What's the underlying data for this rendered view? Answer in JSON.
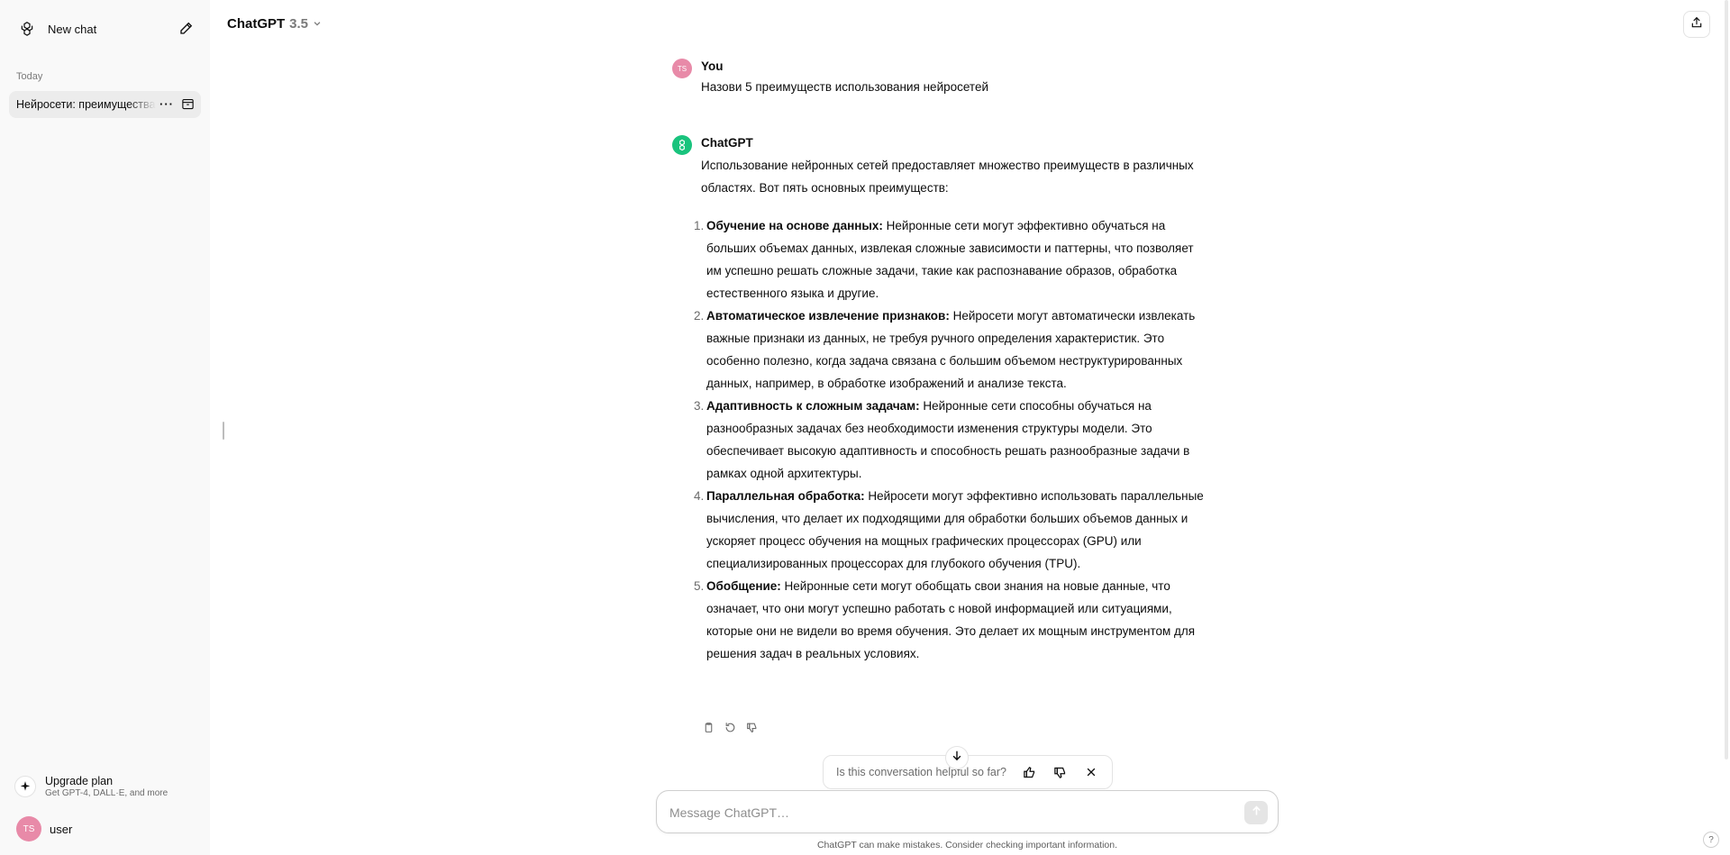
{
  "sidebar": {
    "new_chat_label": "New chat",
    "section_today": "Today",
    "chat_items": [
      {
        "title": "Нейросети: преимущества"
      }
    ],
    "upgrade": {
      "title": "Upgrade plan",
      "subtitle": "Get GPT-4, DALL·E, and more"
    },
    "user": {
      "initials": "TS",
      "name": "user"
    }
  },
  "header": {
    "model_name": "ChatGPT",
    "model_version": "3.5"
  },
  "conversation": {
    "user_message": {
      "author": "You",
      "initials": "TS",
      "text": "Назови 5 преимуществ использования нейросетей"
    },
    "assistant_message": {
      "author": "ChatGPT",
      "intro": "Использование нейронных сетей предоставляет множество преимуществ в различных областях. Вот пять основных преимуществ:",
      "items": [
        {
          "num": "1.",
          "title": "Обучение на основе данных:",
          "text": " Нейронные сети могут эффективно обучаться на больших объемах данных, извлекая сложные зависимости и паттерны, что позволяет им успешно решать сложные задачи, такие как распознавание образов, обработка естественного языка и другие."
        },
        {
          "num": "2.",
          "title": "Автоматическое извлечение признаков:",
          "text": " Нейросети могут автоматически извлекать важные признаки из данных, не требуя ручного определения характеристик. Это особенно полезно, когда задача связана с большим объемом неструктурированных данных, например, в обработке изображений и анализе текста."
        },
        {
          "num": "3.",
          "title": "Адаптивность к сложным задачам:",
          "text": " Нейронные сети способны обучаться на разнообразных задачах без необходимости изменения структуры модели. Это обеспечивает высокую адаптивность и способность решать разнообразные задачи в рамках одной архитектуры."
        },
        {
          "num": "4.",
          "title": "Параллельная обработка:",
          "text": " Нейросети могут эффективно использовать параллельные вычисления, что делает их подходящими для обработки больших объемов данных и ускоряет процесс обучения на мощных графических процессорах (GPU) или специализированных процессорах для глубокого обучения (TPU)."
        },
        {
          "num": "5.",
          "title": "Обобщение:",
          "text": " Нейронные сети могут обобщать свои знания на новые данные, что означает, что они могут успешно работать с новой информацией или ситуациями, которые они не видели во время обучения. Это делает их мощным инструментом для решения задач в реальных условиях."
        }
      ]
    }
  },
  "feedback": {
    "question": "Is this conversation helpful so far?"
  },
  "composer": {
    "placeholder": "Message ChatGPT…"
  },
  "footer": {
    "disclaimer": "ChatGPT can make mistakes. Consider checking important information.",
    "help": "?"
  },
  "colors": {
    "accent_green": "#19c37d",
    "user_avatar": "#e88aa8",
    "sidebar_bg": "#f9f9f9"
  }
}
